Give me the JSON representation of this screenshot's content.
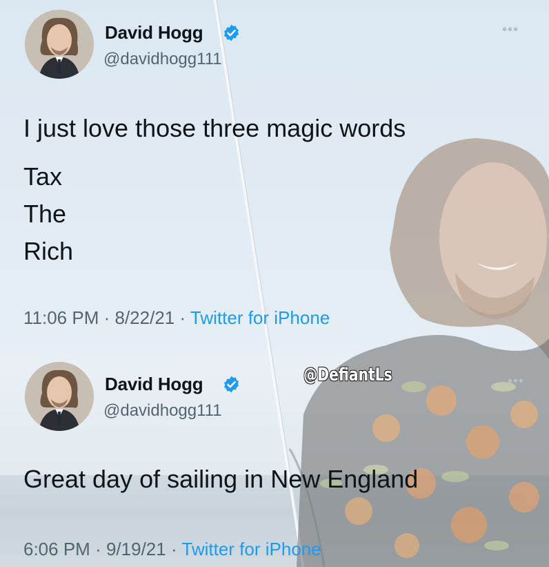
{
  "colors": {
    "text": "#0f1419",
    "secondary": "#536471",
    "link": "#1d9bf0",
    "verified": "#1d9bf0",
    "watermark": "#ffffff"
  },
  "watermark": "@DefiantLs",
  "tweets": [
    {
      "author": {
        "name": "David Hogg",
        "handle": "@davidhogg111",
        "avatar_icon": "profile-photo",
        "verified_icon": "verified-badge-icon"
      },
      "more_icon": "more-options-icon",
      "lines": [
        "I just love those three magic words",
        "Tax",
        "The",
        "Rich"
      ],
      "time": "11:06 PM",
      "date": "8/22/21",
      "source": "Twitter for iPhone",
      "separator": "·"
    },
    {
      "author": {
        "name": "David Hogg",
        "handle": "@davidhogg111",
        "avatar_icon": "profile-photo",
        "verified_icon": "verified-badge-icon"
      },
      "more_icon": "more-options-icon",
      "lines": [
        "Great day of sailing in New England"
      ],
      "time": "6:06 PM",
      "date": "9/19/21",
      "source": "Twitter for iPhone",
      "separator": "·"
    }
  ]
}
